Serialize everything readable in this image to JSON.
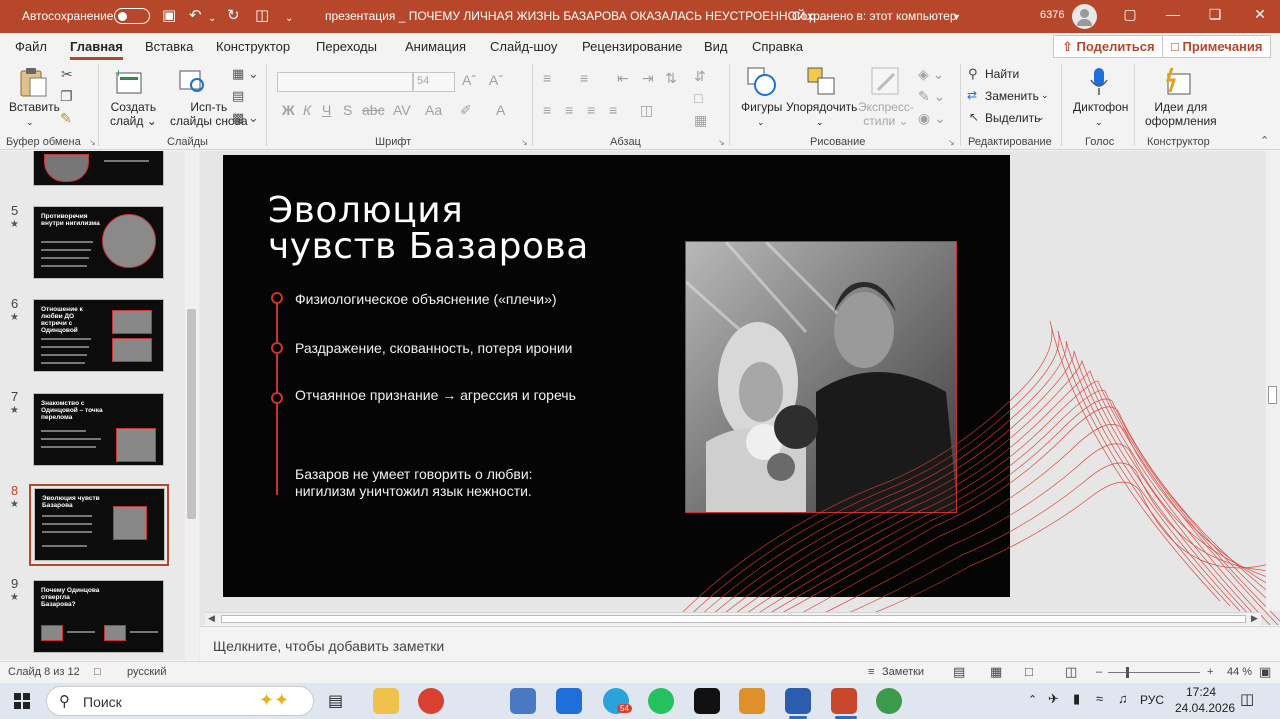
{
  "titlebar": {
    "autosave_label": "Автосохранение",
    "autosave_state": "off",
    "doc_title": "презентация _ ПОЧЕМУ ЛИЧНАЯ ЖИЗНЬ БАЗАРОВА ОКАЗАЛАСЬ НЕУСТРОЕННОЙ.p...",
    "saved_status": "Сохранено в: этот компьютер",
    "user_code": "6376",
    "accent_color": "#b7472a"
  },
  "tabs": [
    "Файл",
    "Главная",
    "Вставка",
    "Конструктор",
    "Переходы",
    "Анимация",
    "Слайд-шоу",
    "Рецензирование",
    "Вид",
    "Справка"
  ],
  "active_tab": "Главная",
  "share_label": "Поделиться",
  "comments_label": "Примечания",
  "ribbon": {
    "clipboard": {
      "paste": "Вставить",
      "group": "Буфер обмена"
    },
    "slides": {
      "new_slide": "Создать слайд",
      "reuse": "Исп-ть слайды снова",
      "group": "Слайды"
    },
    "font": {
      "size": "54",
      "group": "Шрифт"
    },
    "paragraph": {
      "group": "Абзац"
    },
    "drawing": {
      "shapes": "Фигуры",
      "arrange": "Упорядочить",
      "quick_styles": "Экспресс-стили",
      "group": "Рисование"
    },
    "editing": {
      "find": "Найти",
      "replace": "Заменить",
      "select": "Выделить",
      "group": "Редактирование"
    },
    "voice": {
      "dictate": "Диктофон",
      "group": "Голос"
    },
    "designer": {
      "ideas": "Идеи для оформления",
      "group": "Конструктор"
    }
  },
  "thumbnails": [
    {
      "num": "5",
      "title": "Противоречия внутри нигилизма"
    },
    {
      "num": "6",
      "title": "Отношение к любви ДО встречи с Одинцовой"
    },
    {
      "num": "7",
      "title": "Знакомство с Одинцовой – точка перелома"
    },
    {
      "num": "8",
      "title": "Эволюция чувств Базарова"
    },
    {
      "num": "9",
      "title": "Почему Одинцова отвергла Базарова?"
    }
  ],
  "selected_slide": "8",
  "slide": {
    "title_line1": "Эволюция",
    "title_line2": "чувств Базарова",
    "bullets": [
      "Физиологическое объяснение («плечи»)",
      "Раздражение, скованность, потеря иронии",
      "Отчаянное признание → агрессия и горечь"
    ],
    "note_line1": "Базаров не умеет говорить о любви:",
    "note_line2": "нигилизм уничтожил язык нежности.",
    "accent_color": "#c9332a"
  },
  "notes_placeholder": "Щелкните, чтобы добавить заметки",
  "status": {
    "slide_counter": "Слайд 8 из 12",
    "language": "русский",
    "notes_label": "Заметки",
    "zoom": "44 %"
  },
  "taskbar": {
    "search": "Поиск",
    "telegram_badge": "54",
    "lang": "РУС",
    "time": "17:24",
    "date": "24.04.2026"
  }
}
